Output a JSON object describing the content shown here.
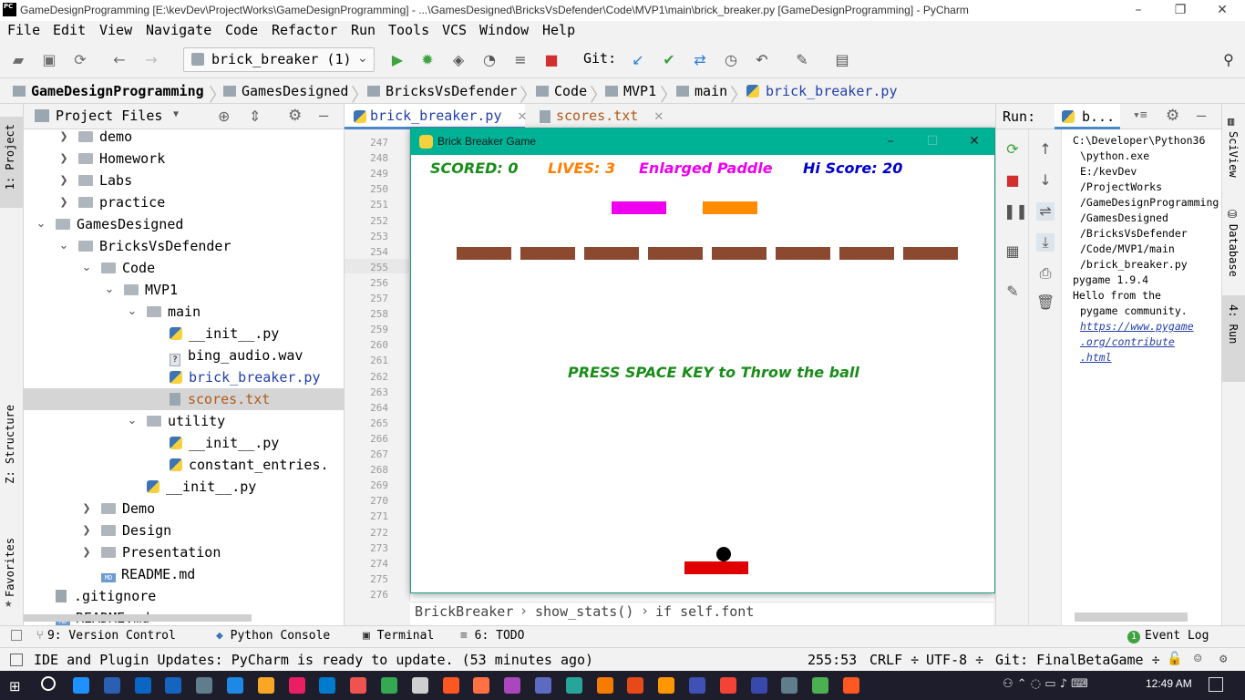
{
  "window": {
    "title": "GameDesignProgramming [E:\\kevDev\\ProjectWorks\\GameDesignProgramming] - ...\\GamesDesigned\\BricksVsDefender\\Code\\MVP1\\main\\brick_breaker.py [GameDesignProgramming] - PyCharm",
    "logo_text": "PC"
  },
  "menu": [
    "File",
    "Edit",
    "View",
    "Navigate",
    "Code",
    "Refactor",
    "Run",
    "Tools",
    "VCS",
    "Window",
    "Help"
  ],
  "toolbar": {
    "run_config": "brick_breaker (1)",
    "git_label": "Git:"
  },
  "breadcrumb": [
    "GameDesignProgramming",
    "GamesDesigned",
    "BricksVsDefender",
    "Code",
    "MVP1",
    "main",
    "brick_breaker.py"
  ],
  "left_strip": {
    "project": "1: Project",
    "structure": "Z: Structure",
    "favorites": "Favorites"
  },
  "project_panel": {
    "title": "Project Files",
    "tree": [
      {
        "label": "demo",
        "type": "folder",
        "depth": 2,
        "chevron": "›"
      },
      {
        "label": "Homework",
        "type": "folder",
        "depth": 2,
        "chevron": "›"
      },
      {
        "label": "Labs",
        "type": "folder",
        "depth": 2,
        "chevron": "›"
      },
      {
        "label": "practice",
        "type": "folder",
        "depth": 2,
        "chevron": "›"
      },
      {
        "label": "GamesDesigned",
        "type": "folder",
        "depth": 1,
        "chevron": "⌄"
      },
      {
        "label": "BricksVsDefender",
        "type": "folder",
        "depth": 2,
        "chevron": "⌄"
      },
      {
        "label": "Code",
        "type": "folder",
        "depth": 3,
        "chevron": "⌄"
      },
      {
        "label": "MVP1",
        "type": "folder",
        "depth": 4,
        "chevron": "⌄"
      },
      {
        "label": "main",
        "type": "folder",
        "depth": 5,
        "chevron": "⌄"
      },
      {
        "label": "__init__.py",
        "type": "py",
        "depth": 6
      },
      {
        "label": "bing_audio.wav",
        "type": "unknown",
        "depth": 6
      },
      {
        "label": "brick_breaker.py",
        "type": "py",
        "depth": 6,
        "color": "#2340a8"
      },
      {
        "label": "scores.txt",
        "type": "txt",
        "depth": 6,
        "color": "#b05a1a",
        "selected": true
      },
      {
        "label": "utility",
        "type": "folder",
        "depth": 5,
        "chevron": "⌄"
      },
      {
        "label": "__init__.py",
        "type": "py",
        "depth": 6
      },
      {
        "label": "constant_entries.",
        "type": "py",
        "depth": 6
      },
      {
        "label": "__init__.py",
        "type": "py",
        "depth": 5
      },
      {
        "label": "Demo",
        "type": "folder",
        "depth": 3,
        "chevron": "›"
      },
      {
        "label": "Design",
        "type": "folder",
        "depth": 3,
        "chevron": "›"
      },
      {
        "label": "Presentation",
        "type": "folder",
        "depth": 3,
        "chevron": "›"
      },
      {
        "label": "README.md",
        "type": "md",
        "depth": 3
      },
      {
        "label": ".gitignore",
        "type": "txt",
        "depth": 1
      },
      {
        "label": "README.md",
        "type": "md",
        "depth": 1
      }
    ]
  },
  "editor": {
    "tabs": [
      {
        "label": "brick_breaker.py",
        "active": true,
        "color": "#2340a8"
      },
      {
        "label": "scores.txt",
        "active": false,
        "color": "#b05a1a"
      }
    ],
    "line_numbers": [
      "247",
      "248",
      "249",
      "250",
      "251",
      "252",
      "253",
      "254",
      "255",
      "256",
      "257",
      "258",
      "259",
      "260",
      "261",
      "262",
      "263",
      "264",
      "265",
      "266",
      "267",
      "268",
      "269",
      "270",
      "271",
      "272",
      "273",
      "274",
      "275",
      "276"
    ],
    "current_line": "255",
    "code_breadcrumb": [
      "BrickBreaker",
      "show_stats()",
      "if self.font"
    ]
  },
  "game": {
    "title": "Brick Breaker Game",
    "scored": "SCORED: 0",
    "lives": "LIVES: 3",
    "powerup": "Enlarged Paddle",
    "hiscore": "Hi Score: 20",
    "message": "PRESS SPACE KEY to Throw the ball",
    "brick_count": 8,
    "colors": {
      "scored": "#1a8c1a",
      "lives": "#ff7f00",
      "powerup": "#ee00ee",
      "hiscore": "#0000cc",
      "message": "#1a8c1a",
      "brick": "#8b4a2f",
      "paddle": "#e00000",
      "powerup_magenta": "#ee00ee",
      "powerup_orange": "#ff8c00"
    }
  },
  "run_panel": {
    "title": "Run:",
    "tab": "b...",
    "console": [
      {
        "text": "C:\\Developer\\Python36",
        "indent": false
      },
      {
        "text": "\\python.exe",
        "indent": true
      },
      {
        "text": "E:/kevDev",
        "indent": true
      },
      {
        "text": "/ProjectWorks",
        "indent": true
      },
      {
        "text": "/GameDesignProgramming",
        "indent": true
      },
      {
        "text": "/GamesDesigned",
        "indent": true
      },
      {
        "text": "/BricksVsDefender",
        "indent": true
      },
      {
        "text": "/Code/MVP1/main",
        "indent": true
      },
      {
        "text": "/brick_breaker.py",
        "indent": true
      },
      {
        "text": "pygame 1.9.4",
        "indent": false
      },
      {
        "text": "Hello from the",
        "indent": false
      },
      {
        "text": "pygame community.",
        "indent": true
      },
      {
        "text": "https://www.pygame",
        "indent": true,
        "link": true
      },
      {
        "text": ".org/contribute",
        "indent": true,
        "link": true
      },
      {
        "text": ".html",
        "indent": true,
        "link": true
      }
    ]
  },
  "right_strip": {
    "sciview": "SciView",
    "database": "Database",
    "run": "4: Run"
  },
  "bottom_tools": [
    "9: Version Control",
    "Python Console",
    "Terminal",
    "6: TODO"
  ],
  "event_log": {
    "count": "1",
    "label": "Event Log"
  },
  "status": {
    "message": "IDE and Plugin Updates: PyCharm is ready to update. (53 minutes ago)",
    "position": "255:53",
    "line_sep": "CRLF ÷",
    "encoding": "UTF-8 ÷",
    "git": "Git: FinalBetaGame ÷"
  },
  "taskbar": {
    "time": "12:49 AM",
    "apps": [
      "#1e90ff",
      "#2b5fb4",
      "#0a66c2",
      "#1565c0",
      "#607d8b",
      "#1e88e5",
      "#f9a825",
      "#e91e63",
      "#007acc",
      "#ef5350",
      "#34a853",
      "#cfcfcf",
      "#ff5722",
      "#ff7043",
      "#ab47bc",
      "#5c6bc0",
      "#26a69a",
      "#f57c00",
      "#e64a19",
      "#ff9800",
      "#3f51b5",
      "#f44336",
      "#3949ab",
      "#607d8b",
      "#4caf50",
      "#ff5722"
    ]
  }
}
